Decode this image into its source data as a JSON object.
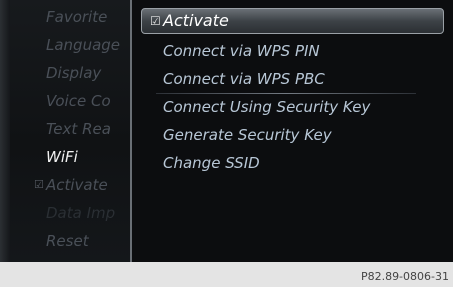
{
  "left_menu": {
    "items": [
      {
        "label": "Favorite"
      },
      {
        "label": "Language"
      },
      {
        "label": "Display"
      },
      {
        "label": "Voice Co"
      },
      {
        "label": "Text Rea"
      },
      {
        "label": "WiFi"
      },
      {
        "label": "Activate"
      },
      {
        "label": "Data Imp"
      },
      {
        "label": "Reset"
      }
    ],
    "check_glyph": "☑"
  },
  "submenu": {
    "items": [
      {
        "label": "Activate"
      },
      {
        "label": "Connect via WPS PIN"
      },
      {
        "label": "Connect via WPS PBC"
      },
      {
        "label": "Connect Using Security Key"
      },
      {
        "label": "Generate Security Key"
      },
      {
        "label": "Change SSID"
      }
    ],
    "check_glyph": "☑"
  },
  "caption": "P82.89-0806-31"
}
